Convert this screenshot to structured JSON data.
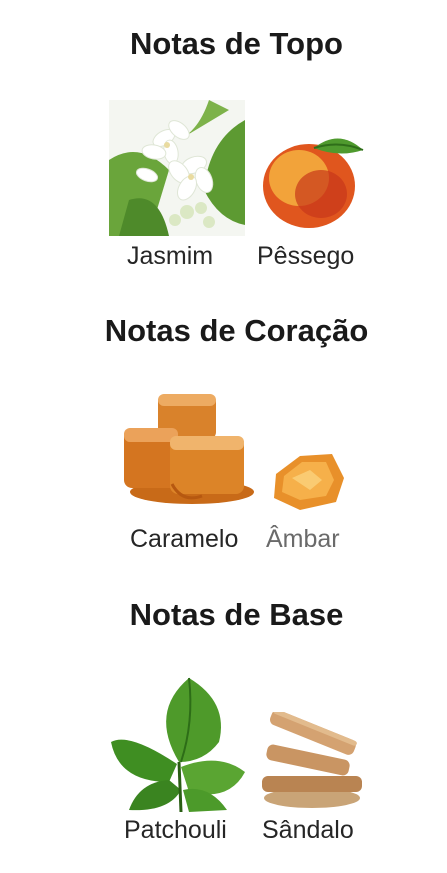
{
  "sections": [
    {
      "title": "Notas de Topo",
      "notes": [
        {
          "label": "Jasmim",
          "icon": "jasmine-flower-image"
        },
        {
          "label": "Pêssego",
          "icon": "peach-image"
        }
      ]
    },
    {
      "title": "Notas de Coração",
      "notes": [
        {
          "label": "Caramelo",
          "icon": "caramel-cubes-image"
        },
        {
          "label": "Âmbar",
          "icon": "amber-resin-image"
        }
      ]
    },
    {
      "title": "Notas de Base",
      "notes": [
        {
          "label": "Patchouli",
          "icon": "patchouli-leaves-image"
        },
        {
          "label": "Sândalo",
          "icon": "sandalwood-sticks-image"
        }
      ]
    }
  ],
  "colors": {
    "title": "#1a1a1a",
    "label": "#262626",
    "label_muted": "#6a6a6a"
  }
}
